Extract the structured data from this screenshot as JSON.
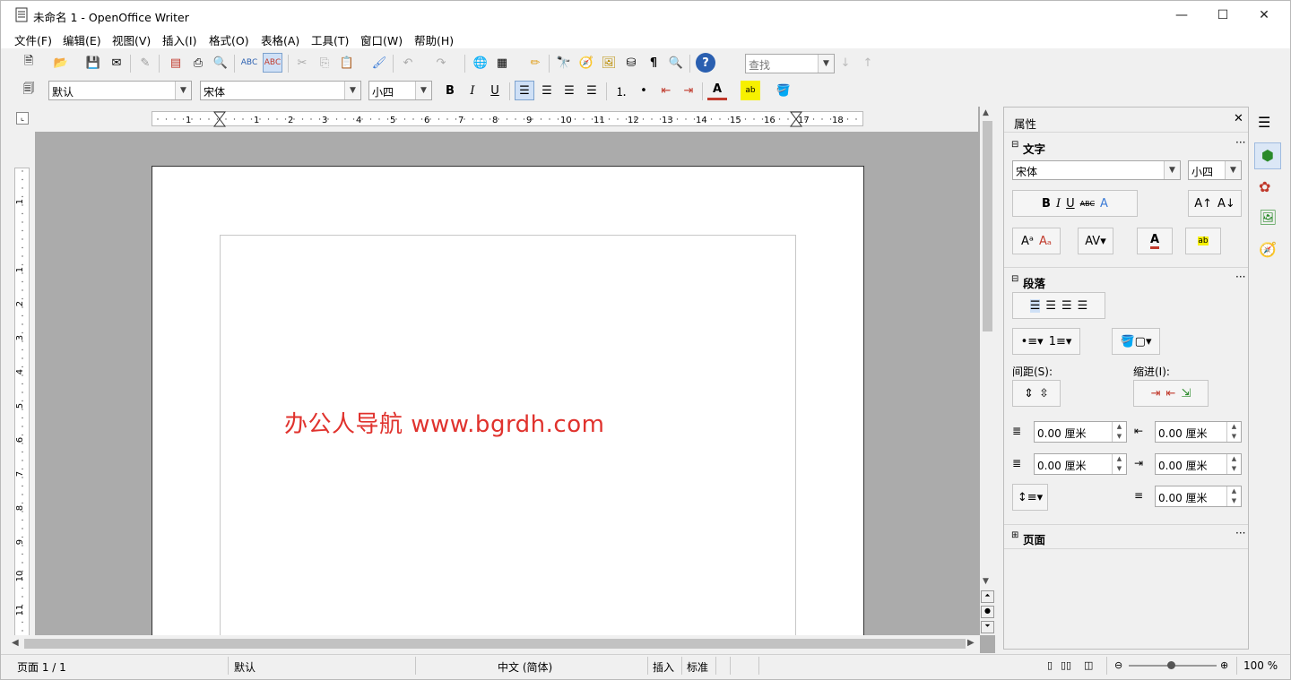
{
  "window": {
    "title": "未命名 1 - OpenOffice Writer",
    "min": "—",
    "max": "☐",
    "close": "✕"
  },
  "menu": [
    "文件(F)",
    "编辑(E)",
    "视图(V)",
    "插入(I)",
    "格式(O)",
    "表格(A)",
    "工具(T)",
    "窗口(W)",
    "帮助(H)"
  ],
  "toolbar": {
    "find_placeholder": "查找"
  },
  "format_toolbar": {
    "style": "默认",
    "font": "宋体",
    "size": "小四",
    "bold": "B",
    "italic": "I",
    "underline": "U"
  },
  "ruler": {
    "h_ticks": [
      "1",
      "1",
      "2",
      "3",
      "4",
      "5",
      "6",
      "7",
      "8",
      "9",
      "10",
      "11",
      "12",
      "13",
      "14",
      "15",
      "16",
      "17",
      "18"
    ],
    "v_ticks": [
      "1",
      "1",
      "2",
      "3",
      "4",
      "5",
      "6",
      "7",
      "8",
      "9",
      "10",
      "11"
    ]
  },
  "document": {
    "watermark": "办公人导航  www.bgrdh.com"
  },
  "sidebar": {
    "title": "属性",
    "close": "✕",
    "text_section": "文字",
    "font": "宋体",
    "size": "小四",
    "paragraph_section": "段落",
    "spacing_label": "间距(S):",
    "indent_label": "缩进(I):",
    "above_spacing": "0.00 厘米",
    "below_spacing": "0.00 厘米",
    "before_indent": "0.00 厘米",
    "after_indent": "0.00 厘米",
    "first_indent": "0.00 厘米",
    "page_section": "页面",
    "more": "···"
  },
  "status": {
    "page": "页面 1 / 1",
    "style": "默认",
    "language": "中文 (简体)",
    "mode": "插入",
    "selection": "标准",
    "zoom": "100 %"
  },
  "colors": {
    "accent": "#3b7bd6",
    "watermark": "#e0322d",
    "doc_bg": "#ababab"
  }
}
